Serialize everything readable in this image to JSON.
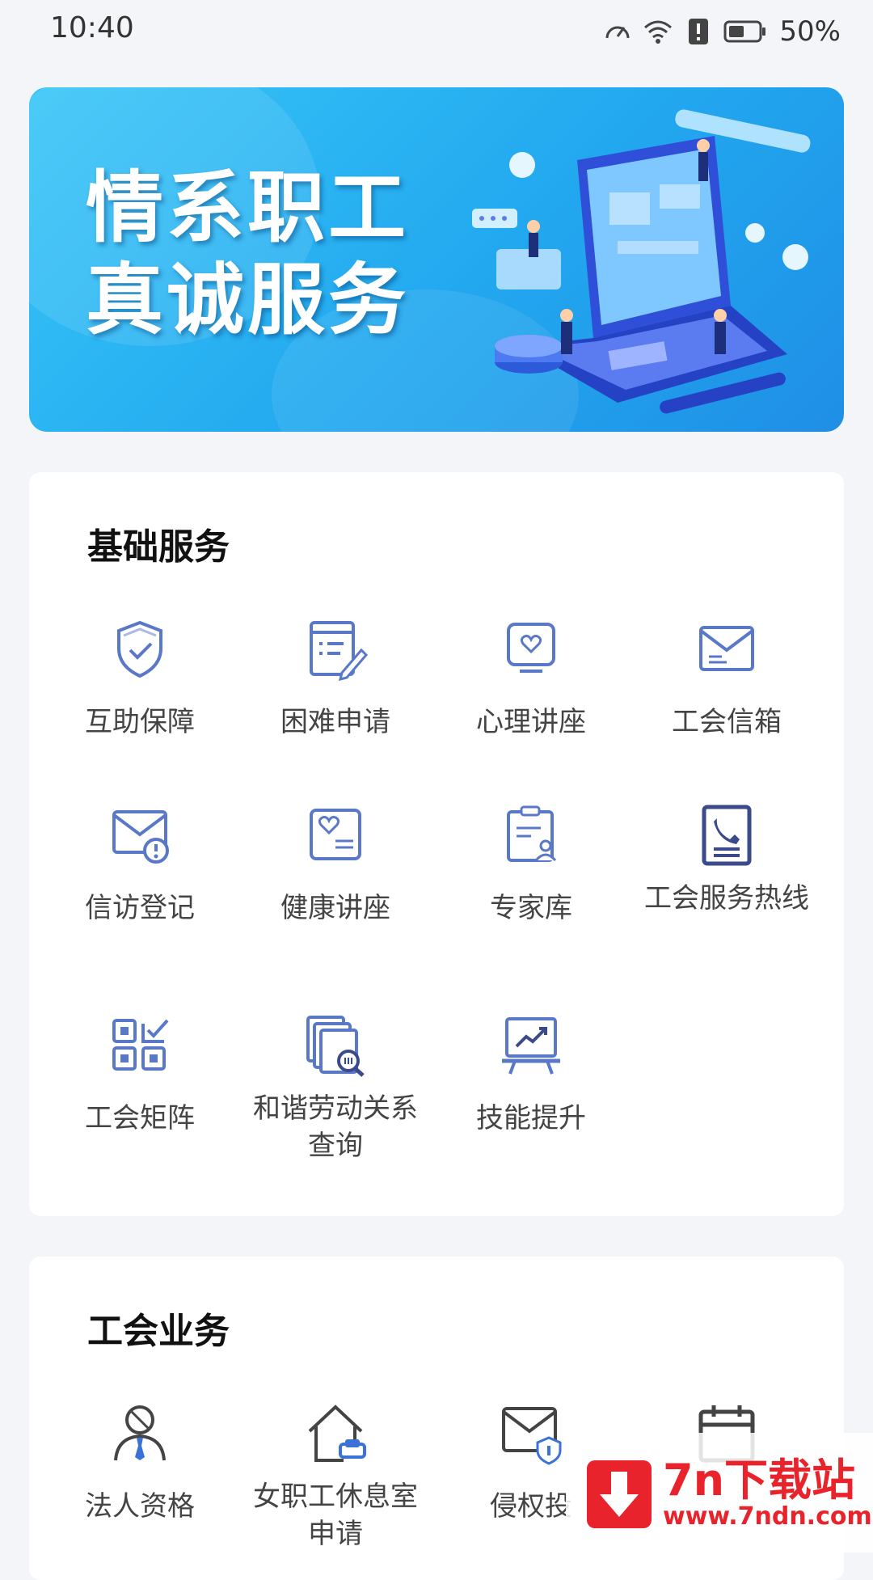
{
  "status_bar": {
    "time": "10:40",
    "battery": "50%"
  },
  "banner": {
    "line1": "情系职工",
    "line2": "真诚服务"
  },
  "sections": [
    {
      "title": "基础服务",
      "items": [
        {
          "label": "互助保障",
          "icon": "shield-check-icon"
        },
        {
          "label": "困难申请",
          "icon": "form-edit-icon"
        },
        {
          "label": "心理讲座",
          "icon": "monitor-heart-icon"
        },
        {
          "label": "工会信箱",
          "icon": "mail-icon"
        },
        {
          "label": "信访登记",
          "icon": "mail-alert-icon"
        },
        {
          "label": "健康讲座",
          "icon": "health-card-icon"
        },
        {
          "label": "专家库",
          "icon": "clipboard-person-icon"
        },
        {
          "label": "工会服务热线",
          "icon": "phone-card-icon"
        },
        {
          "label": "工会矩阵",
          "icon": "grid-check-icon"
        },
        {
          "label": "和谐劳动关系查询",
          "icon": "docs-search-icon"
        },
        {
          "label": "技能提升",
          "icon": "chart-board-icon"
        }
      ]
    },
    {
      "title": "工会业务",
      "items": [
        {
          "label": "法人资格",
          "icon": "person-tie-icon"
        },
        {
          "label": "女职工休息室申请",
          "icon": "house-sofa-icon"
        },
        {
          "label": "侵权投",
          "icon": "mail-shield-icon"
        },
        {
          "label": "",
          "icon": "calendar-icon"
        }
      ]
    }
  ],
  "watermark": {
    "title": "7n下载站",
    "url": "www.7ndn.com"
  },
  "colors": {
    "icon": "#5a78c8",
    "banner": "#22a8ef",
    "accent": "#e8232b"
  }
}
